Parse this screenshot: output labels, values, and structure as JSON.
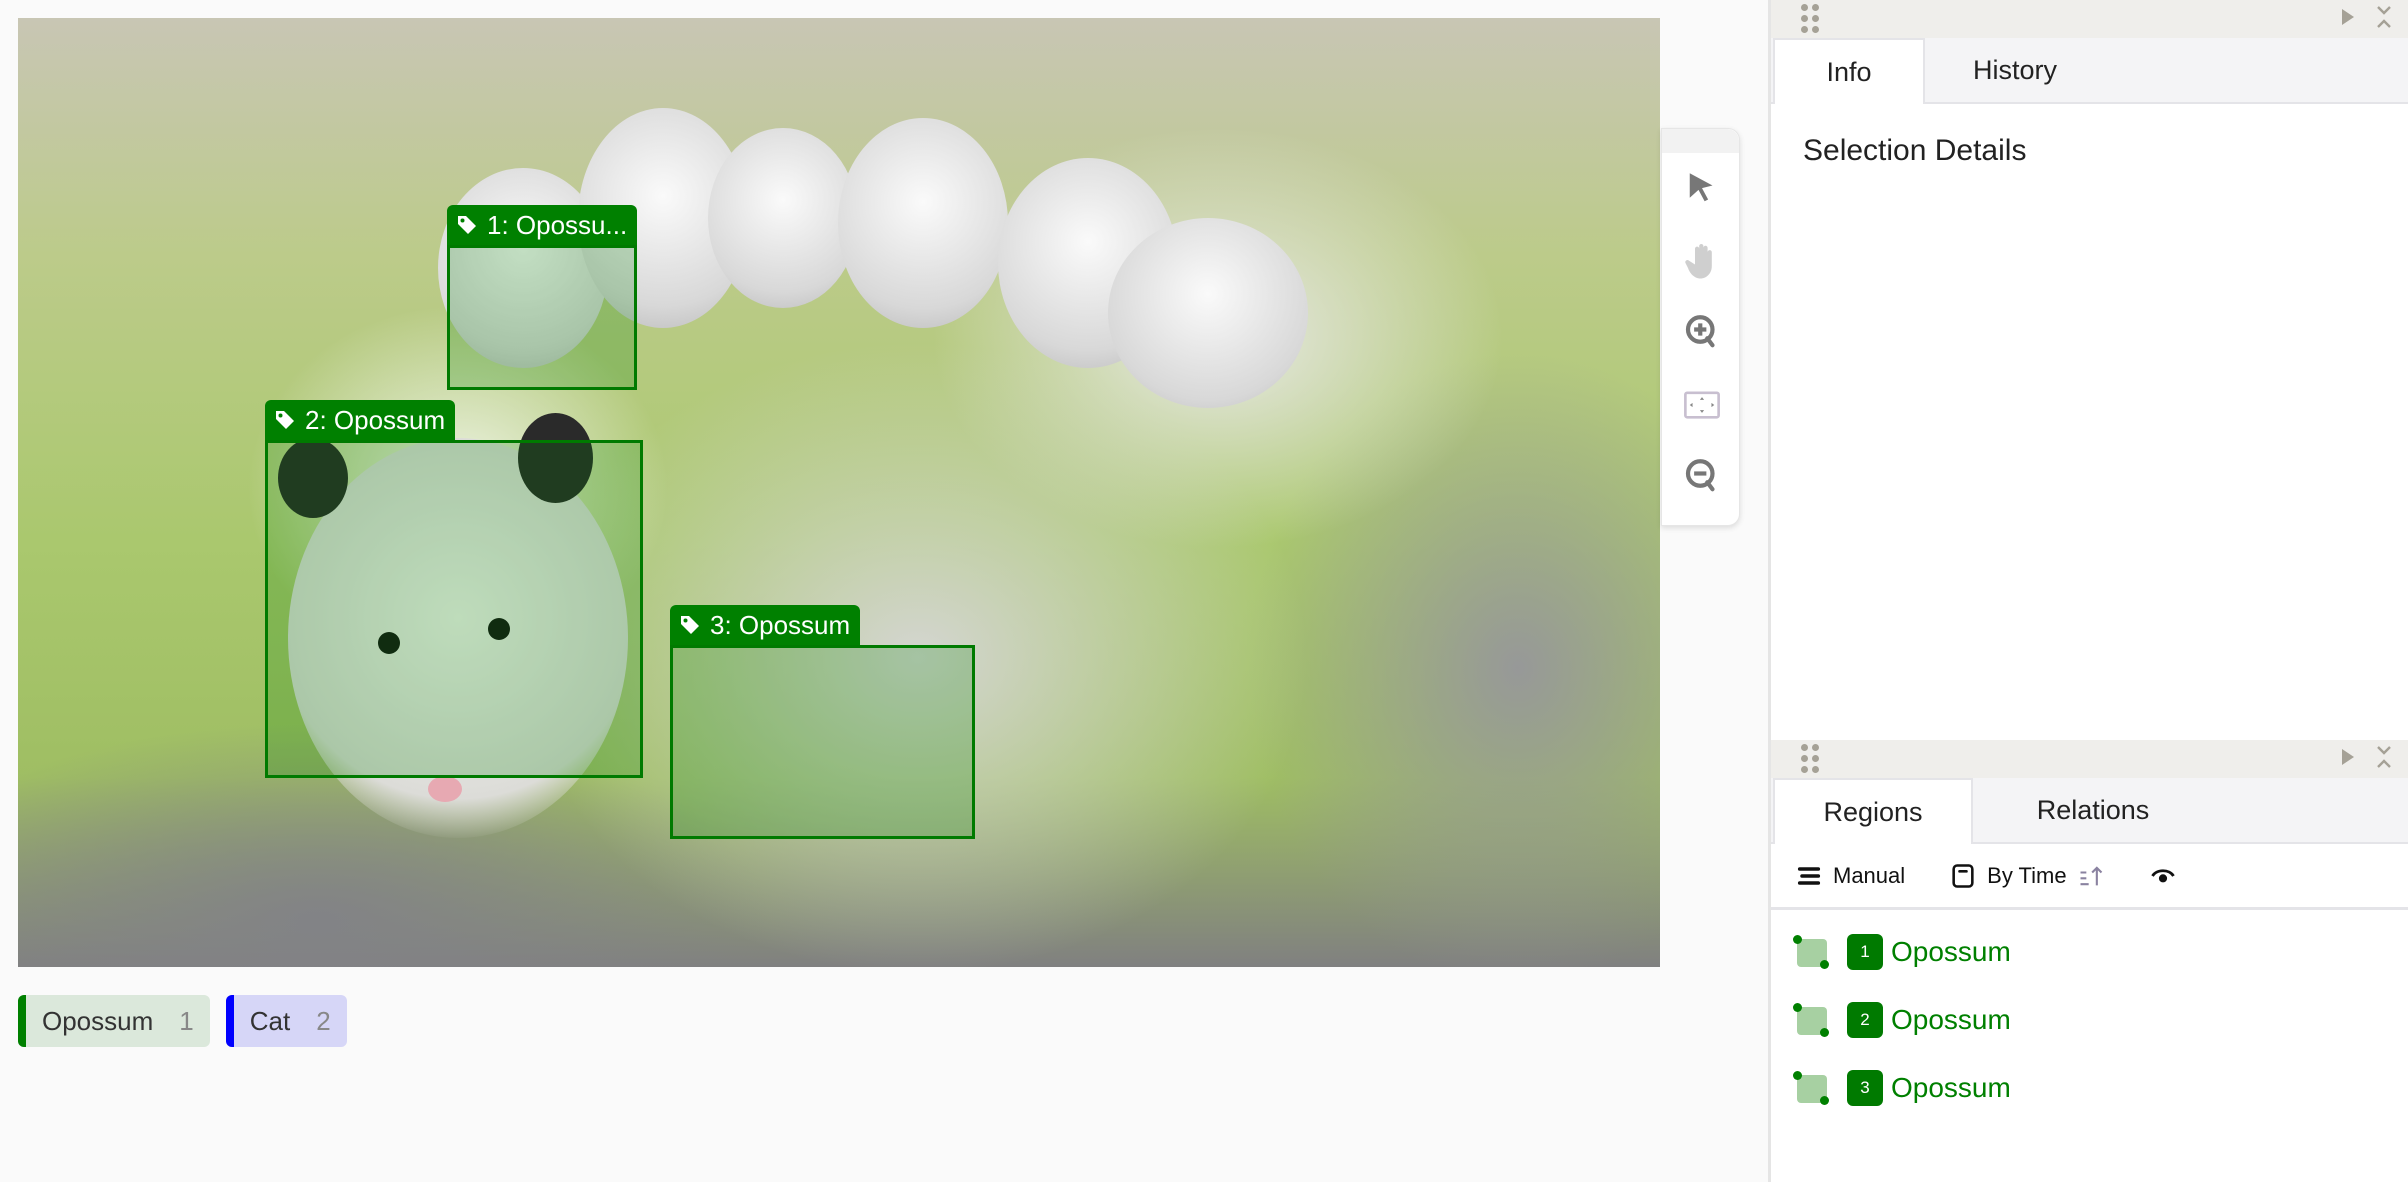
{
  "canvas": {
    "image_alt": "Mother opossum with babies on a log",
    "regions": [
      {
        "id": "1",
        "tag_text": "1: Opossu...",
        "label": "Opossum",
        "color": "#008000"
      },
      {
        "id": "2",
        "tag_text": "2: Opossum",
        "label": "Opossum",
        "color": "#008000"
      },
      {
        "id": "3",
        "tag_text": "3: Opossum",
        "label": "Opossum",
        "color": "#008000"
      }
    ]
  },
  "toolbar": {
    "tools": [
      {
        "name": "select",
        "icon": "cursor-icon",
        "active": true
      },
      {
        "name": "pan",
        "icon": "hand-icon",
        "active": false
      },
      {
        "name": "zoom-in",
        "icon": "zoom-in-icon",
        "active": false
      },
      {
        "name": "zoom-to-fit",
        "icon": "fit-icon",
        "active": false
      },
      {
        "name": "zoom-out",
        "icon": "zoom-out-icon",
        "active": false
      }
    ]
  },
  "labels": [
    {
      "name": "Opossum",
      "count": "1",
      "color": "#008000",
      "bg": "#dbe8db"
    },
    {
      "name": "Cat",
      "count": "2",
      "color": "#0000ff",
      "bg": "#d6d6f7"
    }
  ],
  "side": {
    "top_panel": {
      "tabs": [
        {
          "label": "Info",
          "active": true
        },
        {
          "label": "History",
          "active": false
        }
      ],
      "section_title": "Selection Details"
    },
    "bottom_panel": {
      "tabs": [
        {
          "label": "Regions",
          "active": true
        },
        {
          "label": "Relations",
          "active": false
        }
      ],
      "toolbar": {
        "group_label": "Manual",
        "sort_label": "By Time"
      },
      "regions": [
        {
          "index": "1",
          "label": "Opossum"
        },
        {
          "index": "2",
          "label": "Opossum"
        },
        {
          "index": "3",
          "label": "Opossum"
        }
      ]
    }
  }
}
